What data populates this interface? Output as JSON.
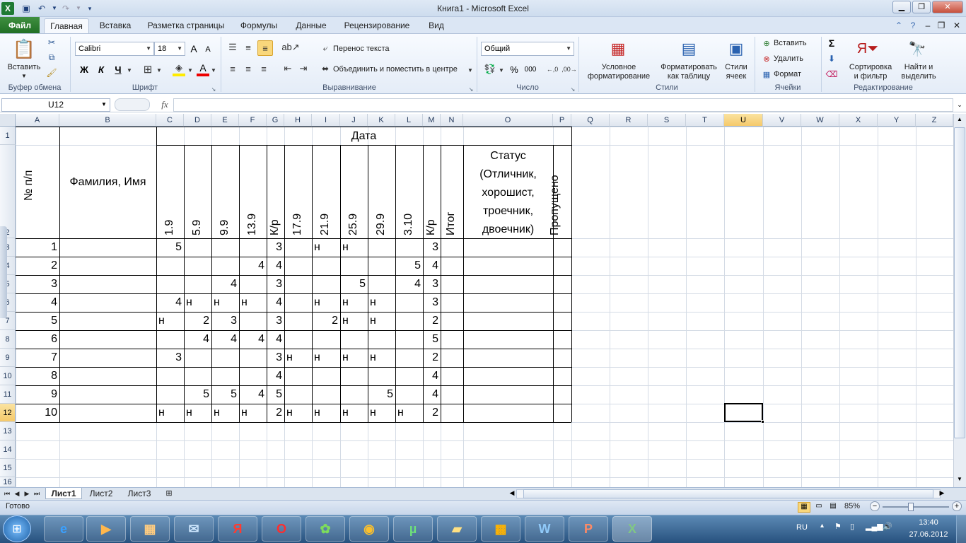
{
  "window": {
    "title": "Книга1  -  Microsoft Excel"
  },
  "ribbon_tabs": [
    "Файл",
    "Главная",
    "Вставка",
    "Разметка страницы",
    "Формулы",
    "Данные",
    "Рецензирование",
    "Вид"
  ],
  "ribbon": {
    "paste": "Вставить",
    "clipboard_group": "Буфер обмена",
    "font_name": "Calibri",
    "font_size": "18",
    "font_group": "Шрифт",
    "bold": "Ж",
    "italic": "К",
    "underline": "Ч",
    "wrap_text": "Перенос текста",
    "merge_center": "Объединить и поместить в центре",
    "align_group": "Выравнивание",
    "number_format": "Общий",
    "number_group": "Число",
    "cond_format_1": "Условное",
    "cond_format_2": "форматирование",
    "format_table_1": "Форматировать",
    "format_table_2": "как таблицу",
    "cell_styles_1": "Стили",
    "cell_styles_2": "ячеек",
    "styles_group": "Стили",
    "insert": "Вставить",
    "delete": "Удалить",
    "format": "Формат",
    "cells_group": "Ячейки",
    "sort_1": "Сортировка",
    "sort_2": "и фильтр",
    "find_1": "Найти и",
    "find_2": "выделить",
    "editing_group": "Редактирование",
    "percent": "%",
    "thousands": "000",
    "sigma": "Σ"
  },
  "formula_bar": {
    "name_box": "U12",
    "fx": "fx",
    "formula": ""
  },
  "columns": [
    "A",
    "B",
    "C",
    "D",
    "E",
    "F",
    "G",
    "H",
    "I",
    "J",
    "K",
    "L",
    "M",
    "N",
    "O",
    "P",
    "Q",
    "R",
    "S",
    "T",
    "U",
    "V",
    "W",
    "X",
    "Y",
    "Z"
  ],
  "rows": [
    "1",
    "2",
    "3",
    "4",
    "5",
    "6",
    "7",
    "8",
    "9",
    "10",
    "11",
    "12",
    "13",
    "14",
    "15",
    "16"
  ],
  "sheet": {
    "header_num": "№ п/п",
    "header_name": "Фамилия, Имя",
    "header_date": "Дата",
    "date_cols": [
      "1.9",
      "5.9",
      "9.9",
      "13.9",
      "К/р",
      "17.9",
      "21.9",
      "25.9",
      "29.9",
      "3.10",
      "К/р",
      "Итог"
    ],
    "status_lines": [
      "Статус",
      "(Отличник,",
      "хорошист,",
      "троечник,",
      "двоечник)"
    ],
    "skipped": "Пропущено",
    "data_rows": [
      [
        "1",
        "5",
        "",
        "",
        "",
        "3",
        "",
        "н",
        "н",
        "",
        "",
        "3"
      ],
      [
        "2",
        "",
        "",
        "",
        "4",
        "4",
        "",
        "",
        "",
        "",
        "5",
        "4"
      ],
      [
        "3",
        "",
        "",
        "4",
        "",
        "3",
        "",
        "",
        "5",
        "",
        "4",
        "3"
      ],
      [
        "4",
        "4",
        "н",
        "н",
        "н",
        "4",
        "",
        "н",
        "н",
        "н",
        "",
        "3"
      ],
      [
        "5",
        "н",
        "2",
        "3",
        "",
        "3",
        "",
        "2",
        "н",
        "н",
        "",
        "2"
      ],
      [
        "6",
        "",
        "4",
        "4",
        "4",
        "4",
        "",
        "",
        "",
        "",
        "",
        "5"
      ],
      [
        "7",
        "3",
        "",
        "",
        "",
        "3",
        "н",
        "н",
        "н",
        "н",
        "",
        "2"
      ],
      [
        "8",
        "",
        "",
        "",
        "",
        "4",
        "",
        "",
        "",
        "",
        "",
        "4"
      ],
      [
        "9",
        "",
        "5",
        "5",
        "4",
        "5",
        "",
        "",
        "",
        "5",
        "",
        "4"
      ],
      [
        "10",
        "н",
        "н",
        "н",
        "н",
        "2",
        "н",
        "н",
        "н",
        "н",
        "н",
        "2"
      ]
    ]
  },
  "sheet_tabs": [
    "Лист1",
    "Лист2",
    "Лист3"
  ],
  "status": {
    "ready": "Готово",
    "zoom": "85%"
  },
  "tray": {
    "lang": "RU",
    "time": "13:40",
    "date": "27.06.2012"
  }
}
